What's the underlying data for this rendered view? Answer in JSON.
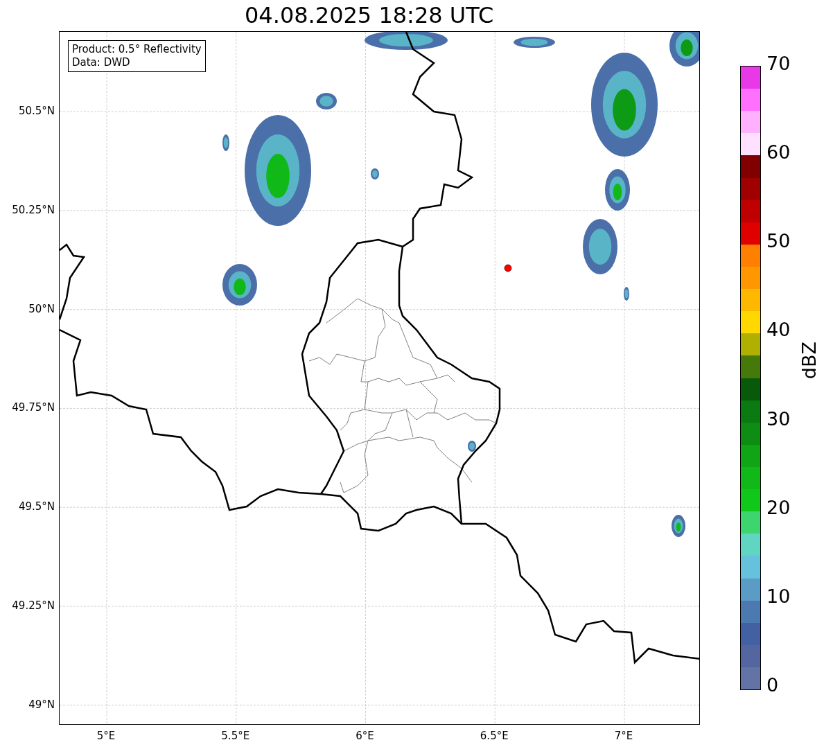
{
  "title": "04.08.2025 18:28 UTC",
  "info_box": [
    "Product: 0.5° Reflectivity",
    "Data: DWD"
  ],
  "lat_ticks": [
    "50.5°N",
    "50.25°N",
    "50°N",
    "49.75°N",
    "49.5°N",
    "49.25°N",
    "49°N"
  ],
  "lon_ticks": [
    "5°E",
    "5.5°E",
    "6°E",
    "6.5°E",
    "7°E"
  ],
  "colorbar": {
    "label": "dBZ",
    "ticks": [
      "70",
      "60",
      "50",
      "40",
      "30",
      "20",
      "10",
      "0"
    ],
    "colors": [
      {
        "color": "#e838e8"
      },
      {
        "color": "#ff70ff"
      },
      {
        "color": "#ffb0ff"
      },
      {
        "color": "#ffe0ff"
      },
      {
        "color": "#800000"
      },
      {
        "color": "#a00000"
      },
      {
        "color": "#c00000"
      },
      {
        "color": "#e00000"
      },
      {
        "color": "#ff8000"
      },
      {
        "color": "#ff9800"
      },
      {
        "color": "#ffb800"
      },
      {
        "color": "#ffd800"
      },
      {
        "color": "#b0b000"
      },
      {
        "color": "#457a0a"
      },
      {
        "color": "#085a0a"
      },
      {
        "color": "#0b7a11"
      },
      {
        "color": "#0d8d13"
      },
      {
        "color": "#10a515"
      },
      {
        "color": "#10b818"
      },
      {
        "color": "#11c81a"
      },
      {
        "color": "#3dd56e"
      },
      {
        "color": "#60d6c2"
      },
      {
        "color": "#66c2dc"
      },
      {
        "color": "#5a9cc5"
      },
      {
        "color": "#4b79b0"
      },
      {
        "color": "#4360a3"
      },
      {
        "color": "#53669f"
      },
      {
        "color": "#6473a6"
      }
    ]
  }
}
